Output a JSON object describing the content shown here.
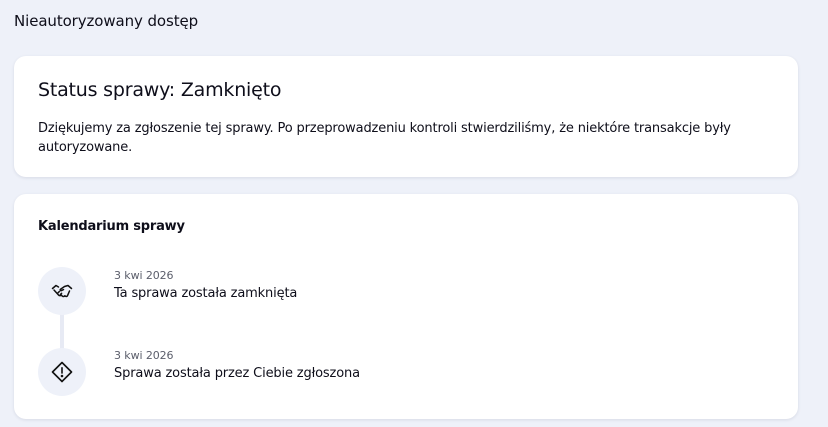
{
  "page": {
    "title": "Nieautoryzowany dostęp"
  },
  "status_card": {
    "heading": "Status sprawy: Zamknięto",
    "description": "Dziękujemy za zgłoszenie tej sprawy. Po przeprowadzeniu kontroli stwierdziliśmy, że niektóre transakcje były autoryzowane."
  },
  "timeline": {
    "heading": "Kalendarium sprawy",
    "events": [
      {
        "date": "3 kwi 2026",
        "title": "Ta sprawa została zamknięta",
        "icon": "handshake-icon"
      },
      {
        "date": "3 kwi 2026",
        "title": "Sprawa została przez Ciebie zgłoszona",
        "icon": "warning-diamond-icon"
      }
    ]
  },
  "colors": {
    "page_background": "#eef1f9",
    "card_background": "#ffffff",
    "text_primary": "#0e0e1a",
    "text_secondary": "#5b5e6b",
    "icon_circle": "#eef1f9",
    "timeline_line": "#e7eaf4"
  }
}
